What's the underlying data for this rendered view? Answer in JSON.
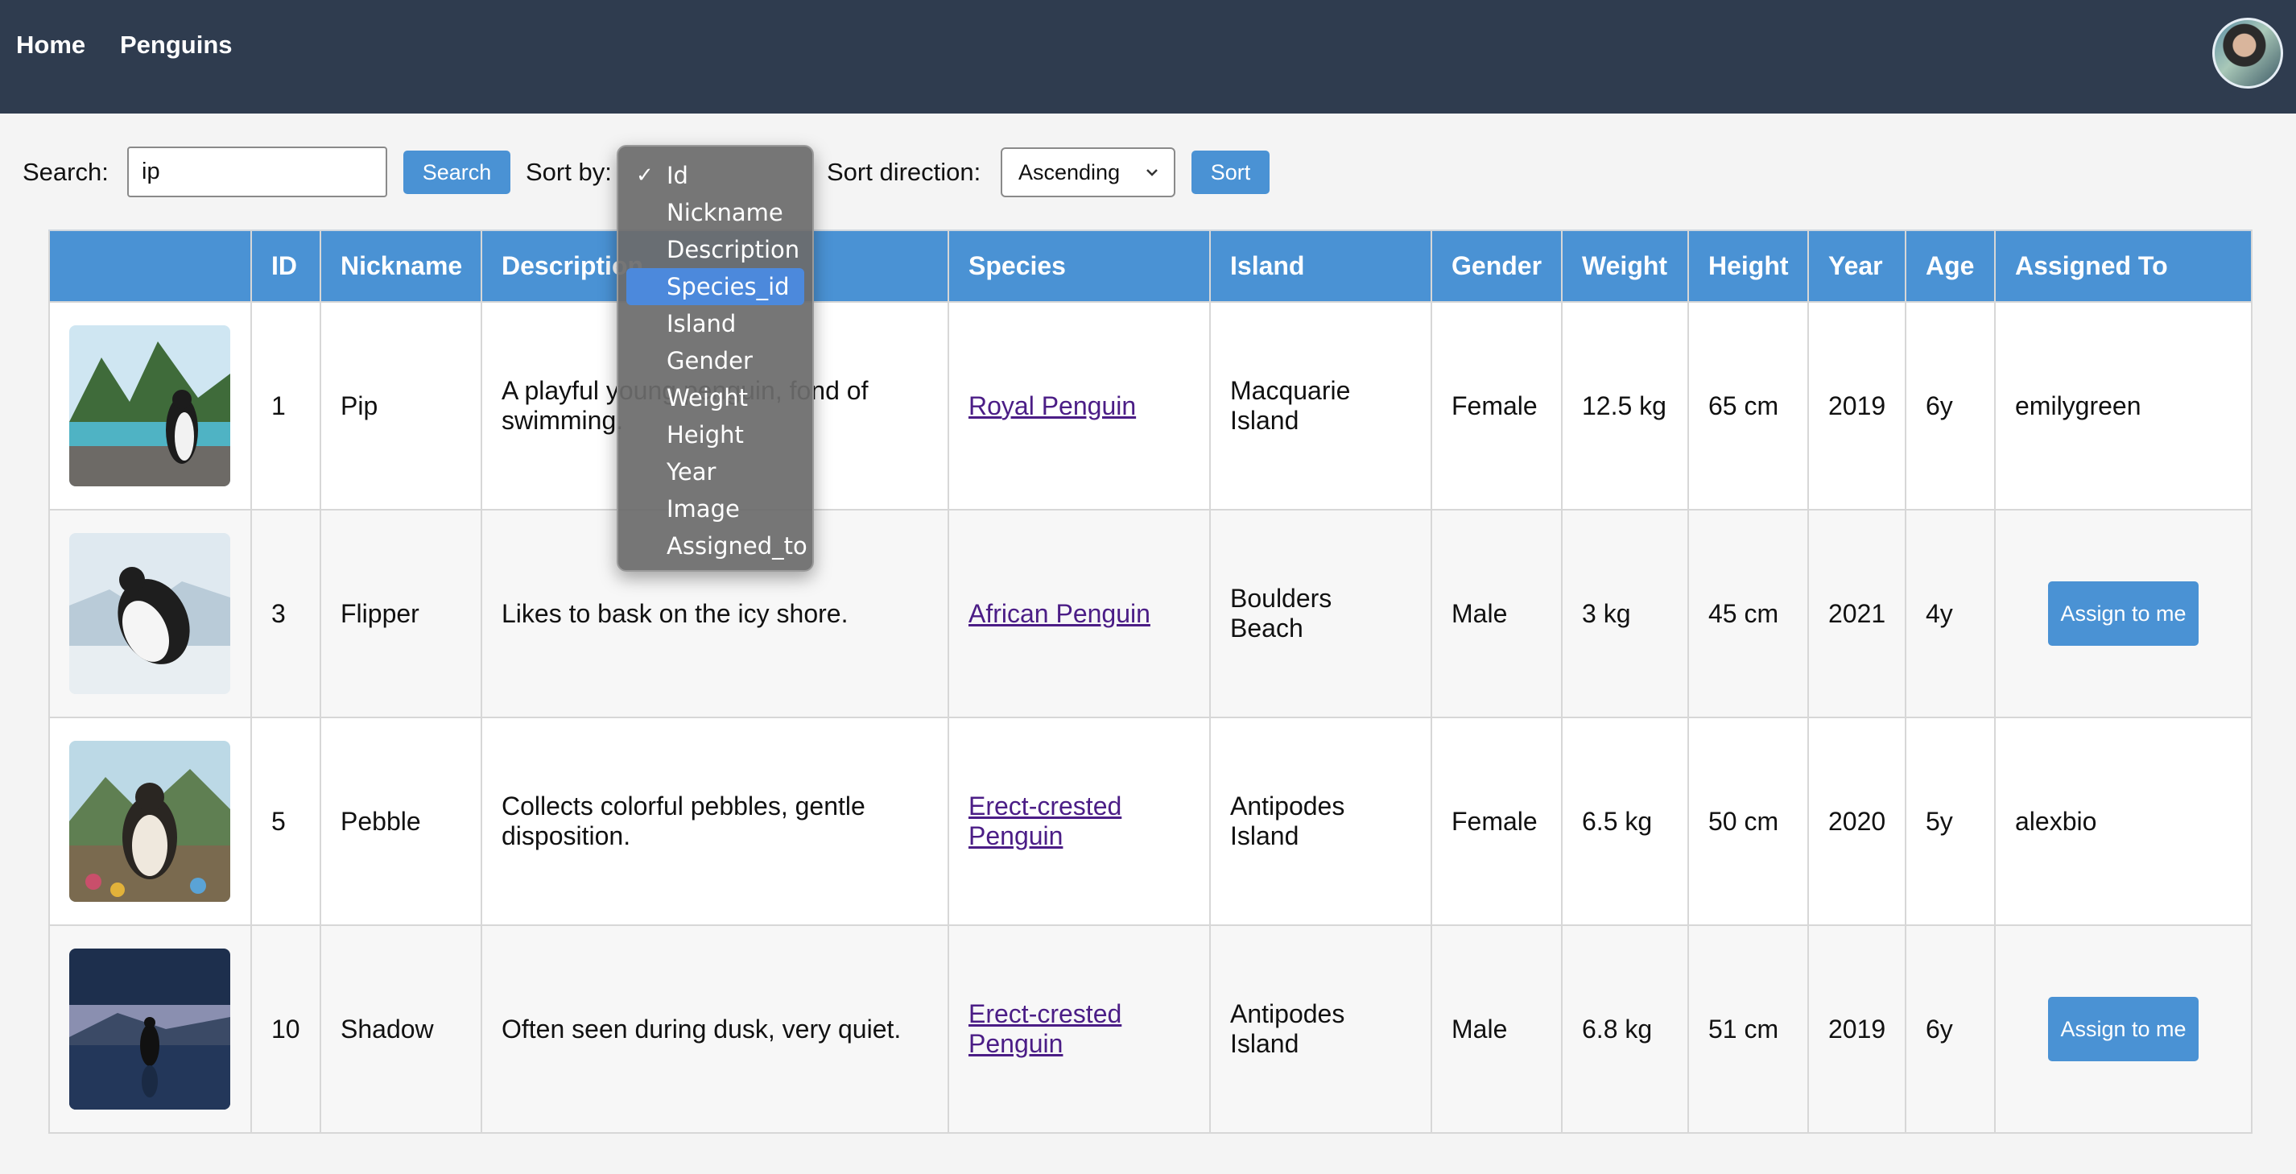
{
  "nav": {
    "home": "Home",
    "penguins": "Penguins"
  },
  "toolbar": {
    "search_label": "Search:",
    "search_value": "ip",
    "search_button": "Search",
    "sort_by_label": "Sort by:",
    "sort_direction_label": "Sort direction:",
    "sort_direction_value": "Ascending",
    "sort_button": "Sort"
  },
  "sort_options": [
    "Id",
    "Nickname",
    "Description",
    "Species_id",
    "Island",
    "Gender",
    "Weight",
    "Height",
    "Year",
    "Image",
    "Assigned_to"
  ],
  "sort_selected": "Id",
  "sort_highlighted": "Species_id",
  "table": {
    "headers": [
      "",
      "ID",
      "Nickname",
      "Description",
      "Species",
      "Island",
      "Gender",
      "Weight",
      "Height",
      "Year",
      "Age",
      "Assigned To"
    ],
    "rows": [
      {
        "id": "1",
        "nickname": "Pip",
        "description": "A playful young penguin, fond of swimming.",
        "species": "Royal Penguin",
        "island": "Macquarie Island",
        "gender": "Female",
        "weight": "12.5 kg",
        "height": "65 cm",
        "year": "2019",
        "age": "6y",
        "assigned": "emilygreen"
      },
      {
        "id": "3",
        "nickname": "Flipper",
        "description": "Likes to bask on the icy shore.",
        "species": "African Penguin",
        "island": "Boulders Beach",
        "gender": "Male",
        "weight": "3 kg",
        "height": "45 cm",
        "year": "2021",
        "age": "4y",
        "assigned": ""
      },
      {
        "id": "5",
        "nickname": "Pebble",
        "description": "Collects colorful pebbles, gentle disposition.",
        "species": "Erect-crested Penguin",
        "island": "Antipodes Island",
        "gender": "Female",
        "weight": "6.5 kg",
        "height": "50 cm",
        "year": "2020",
        "age": "5y",
        "assigned": "alexbio"
      },
      {
        "id": "10",
        "nickname": "Shadow",
        "description": "Often seen during dusk, very quiet.",
        "species": "Erect-crested Penguin",
        "island": "Antipodes Island",
        "gender": "Male",
        "weight": "6.8 kg",
        "height": "51 cm",
        "year": "2019",
        "age": "6y",
        "assigned": ""
      }
    ],
    "assign_button_label": "Assign to me"
  },
  "colors": {
    "nav_bg": "#2f3c4f",
    "accent": "#4a92d4",
    "link": "#4b1d86"
  }
}
